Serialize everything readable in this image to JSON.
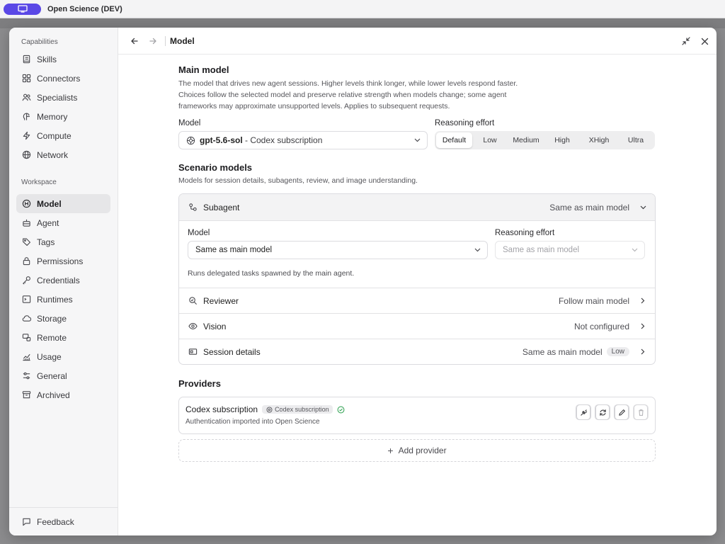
{
  "app": {
    "title": "Open Science (DEV)",
    "accent": "#5a48e6"
  },
  "sidebar": {
    "capabilities_heading": "Capabilities",
    "capabilities": [
      {
        "label": "Skills",
        "icon": "book-icon"
      },
      {
        "label": "Connectors",
        "icon": "grid-icon"
      },
      {
        "label": "Specialists",
        "icon": "people-icon"
      },
      {
        "label": "Memory",
        "icon": "brain-icon"
      },
      {
        "label": "Compute",
        "icon": "bolt-icon"
      },
      {
        "label": "Network",
        "icon": "globe-icon"
      }
    ],
    "workspace_heading": "Workspace",
    "workspace": [
      {
        "label": "Model",
        "icon": "model-icon",
        "active": true
      },
      {
        "label": "Agent",
        "icon": "robot-icon"
      },
      {
        "label": "Tags",
        "icon": "tag-icon"
      },
      {
        "label": "Permissions",
        "icon": "lock-icon"
      },
      {
        "label": "Credentials",
        "icon": "key-icon"
      },
      {
        "label": "Runtimes",
        "icon": "terminal-icon"
      },
      {
        "label": "Storage",
        "icon": "cloud-icon"
      },
      {
        "label": "Remote",
        "icon": "remote-icon"
      },
      {
        "label": "Usage",
        "icon": "chart-icon"
      },
      {
        "label": "General",
        "icon": "sliders-icon"
      },
      {
        "label": "Archived",
        "icon": "archive-icon"
      }
    ],
    "footer": "Feedback"
  },
  "header": {
    "title": "Model"
  },
  "main_model": {
    "title": "Main model",
    "description": "The model that drives new agent sessions. Higher levels think longer, while lower levels respond faster. Choices follow the selected model and preserve relative strength when models change; some agent frameworks may approximate unsupported levels. Applies to subsequent requests.",
    "model_label": "Model",
    "model_name": "gpt-5.6-sol",
    "model_provider": " - Codex subscription",
    "effort_label": "Reasoning effort",
    "effort_options": [
      "Default",
      "Low",
      "Medium",
      "High",
      "XHigh",
      "Ultra"
    ],
    "effort_selected": "Default"
  },
  "scenario": {
    "title": "Scenario models",
    "description": "Models for session details, subagents, review, and image understanding.",
    "subagent": {
      "label": "Subagent",
      "value": "Same as main model",
      "model_label": "Model",
      "model_value": "Same as main model",
      "effort_label": "Reasoning effort",
      "effort_value": "Same as main model",
      "note": "Runs delegated tasks spawned by the main agent."
    },
    "rows": [
      {
        "label": "Reviewer",
        "value": "Follow main model",
        "icon": "review-icon"
      },
      {
        "label": "Vision",
        "value": "Not configured",
        "icon": "eye-icon"
      },
      {
        "label": "Session details",
        "value": "Same as main model",
        "badge": "Low",
        "icon": "details-icon"
      }
    ]
  },
  "providers": {
    "title": "Providers",
    "items": [
      {
        "name": "Codex subscription",
        "tag": "Codex subscription",
        "subtitle": "Authentication imported into Open Science",
        "status": "connected"
      }
    ],
    "add_label": "Add provider"
  }
}
